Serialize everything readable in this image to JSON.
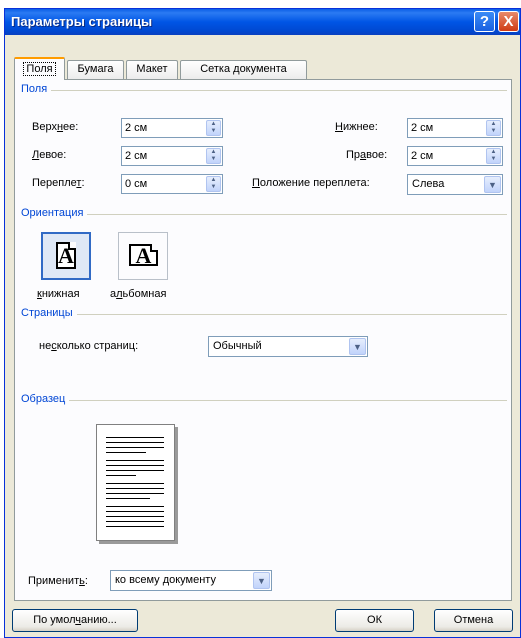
{
  "window": {
    "title": "Параметры страницы",
    "help_glyph": "?",
    "close_glyph": "X"
  },
  "tabs": [
    {
      "label": "Поля",
      "active": true
    },
    {
      "label": "Бумага",
      "active": false
    },
    {
      "label": "Макет",
      "active": false
    },
    {
      "label": "Сетка документа",
      "active": false
    }
  ],
  "margins": {
    "group_title": "Поля",
    "top": {
      "pre": "Верх",
      "key": "н",
      "post": "ее:",
      "value": "2 см"
    },
    "left": {
      "pre": "",
      "key": "Л",
      "post": "евое:",
      "value": "2 см"
    },
    "gutter": {
      "pre": "Перепле",
      "key": "т",
      "post": ":",
      "value": "0 см"
    },
    "bottom": {
      "pre": "",
      "key": "Н",
      "post": "ижнее:",
      "value": "2 см"
    },
    "right": {
      "pre": "Пр",
      "key": "а",
      "post": "вое:",
      "value": "2 см"
    },
    "gutter_pos": {
      "pre": "",
      "key": "П",
      "post": "оложение переплета:",
      "value": "Слева"
    }
  },
  "orientation": {
    "group_title": "Ориентация",
    "portrait": {
      "pre": "",
      "key": "к",
      "post": "нижная",
      "glyph": "A"
    },
    "landscape": {
      "pre": "а",
      "key": "л",
      "post": "ьбомная",
      "glyph": "A"
    }
  },
  "pages": {
    "group_title": "Страницы",
    "multiple": {
      "pre": "не",
      "key": "с",
      "post": "колько страниц:",
      "value": "Обычный"
    }
  },
  "preview": {
    "group_title": "Образец"
  },
  "apply": {
    "pre": "Применит",
    "key": "ь",
    "post": ":",
    "value": "ко всему документу"
  },
  "buttons": {
    "default": {
      "pre": "По умол",
      "key": "ч",
      "post": "анию..."
    },
    "ok": "ОК",
    "cancel": "Отмена"
  }
}
